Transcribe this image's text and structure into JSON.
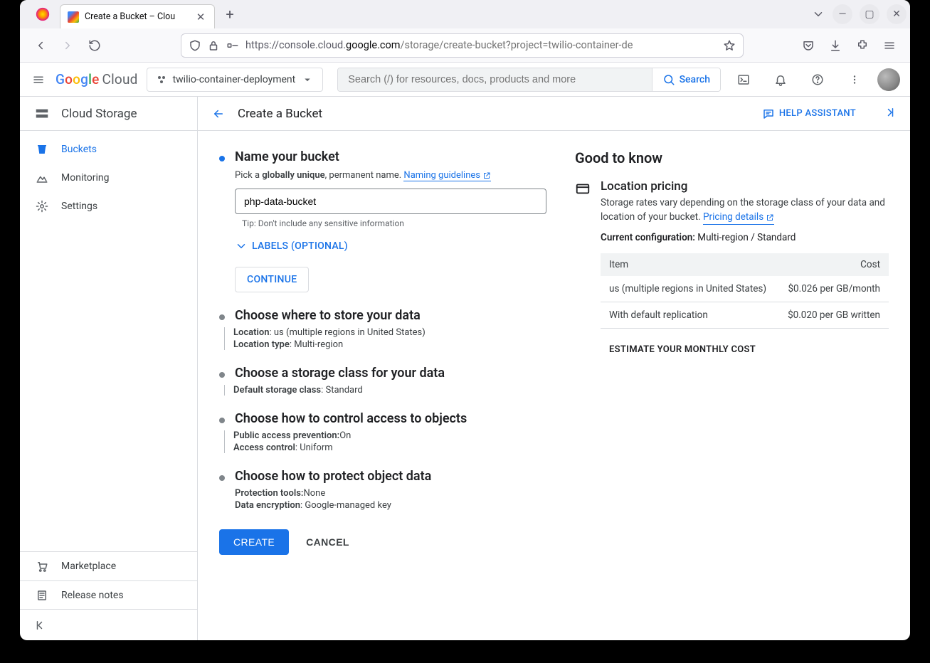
{
  "browser": {
    "tab_title": "Create a Bucket – Clou",
    "url_scheme": "https://",
    "url_host_pre": "console.cloud.",
    "url_host_bold": "google.com",
    "url_path": "/storage/create-bucket?project=twilio-container-de"
  },
  "header": {
    "project": "twilio-container-deployment",
    "search_placeholder": "Search (/) for resources, docs, products and more",
    "search_button": "Search"
  },
  "sidebar": {
    "product_title": "Cloud Storage",
    "items": [
      {
        "label": "Buckets"
      },
      {
        "label": "Monitoring"
      },
      {
        "label": "Settings"
      }
    ],
    "marketplace": "Marketplace",
    "release_notes": "Release notes"
  },
  "page": {
    "back_aria": "Back",
    "title": "Create a Bucket",
    "help_assistant": "HELP ASSISTANT"
  },
  "form": {
    "step1": {
      "title": "Name your bucket",
      "desc_pre": "Pick a ",
      "desc_bold": "globally unique",
      "desc_post": ", permanent name. ",
      "guidelines_link": "Naming guidelines",
      "value": "php-data-bucket",
      "tip": "Tip: Don't include any sensitive information",
      "labels_toggle": "LABELS (OPTIONAL)",
      "continue": "CONTINUE"
    },
    "step2": {
      "title": "Choose where to store your data",
      "location_label": "Location",
      "location_value": "us (multiple regions in United States)",
      "type_label": "Location type",
      "type_value": "Multi-region"
    },
    "step3": {
      "title": "Choose a storage class for your data",
      "class_label": "Default storage class",
      "class_value": "Standard"
    },
    "step4": {
      "title": "Choose how to control access to objects",
      "pap_label": "Public access prevention:",
      "pap_value": "On",
      "ac_label": "Access control",
      "ac_value": "Uniform"
    },
    "step5": {
      "title": "Choose how to protect object data",
      "tools_label": "Protection tools:",
      "tools_value": "None",
      "enc_label": "Data encryption",
      "enc_value": "Google-managed key"
    },
    "create": "CREATE",
    "cancel": "CANCEL"
  },
  "info": {
    "heading": "Good to know",
    "pricing_title": "Location pricing",
    "pricing_body": "Storage rates vary depending on the storage class of your data and location of your bucket.",
    "pricing_link": "Pricing details",
    "config_label": "Current configuration:",
    "config_value": "Multi-region / Standard",
    "table": {
      "h_item": "Item",
      "h_cost": "Cost",
      "rows": [
        {
          "item": "us (multiple regions in United States)",
          "cost": "$0.026 per GB/month"
        },
        {
          "item": "With default replication",
          "cost": "$0.020 per GB written"
        }
      ]
    },
    "estimate": "ESTIMATE YOUR MONTHLY COST"
  }
}
